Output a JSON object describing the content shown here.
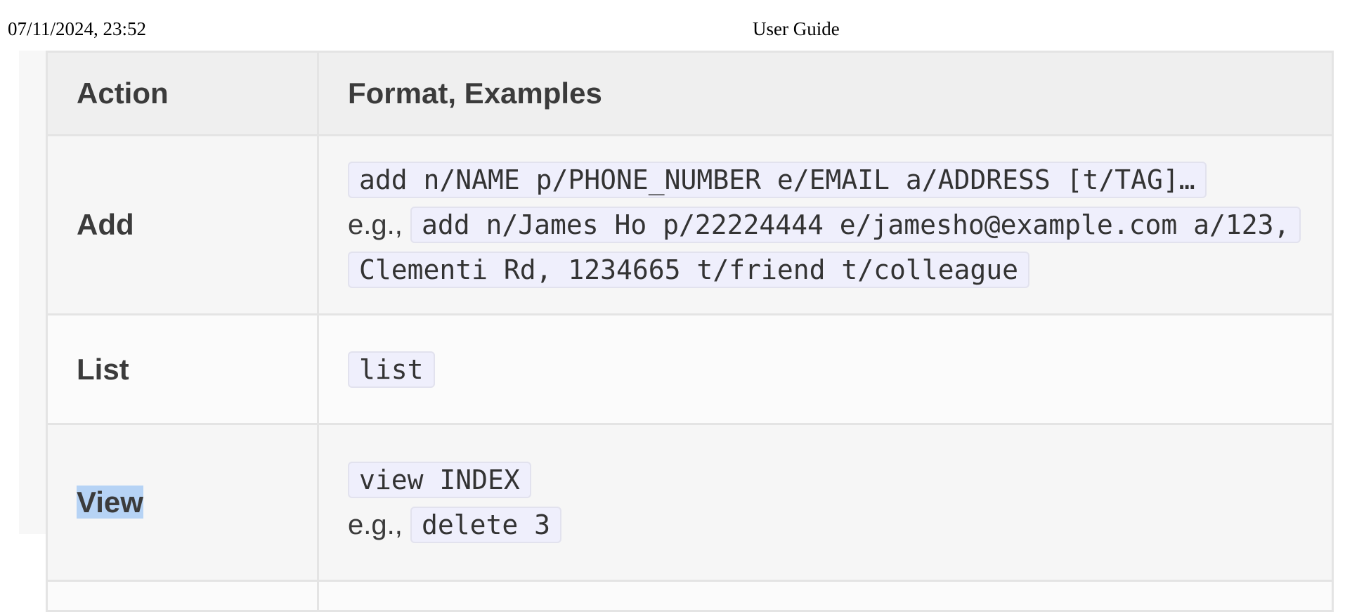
{
  "print_header": {
    "datetime": "07/11/2024, 23:52",
    "title": "User Guide"
  },
  "table": {
    "headers": [
      "Action",
      "Format, Examples"
    ],
    "rows": [
      {
        "action": "Add",
        "format": "add n/NAME p/PHONE_NUMBER e/EMAIL a/ADDRESS [t/TAG]…",
        "example_prefix": "e.g.,",
        "example": "add n/James Ho p/22224444 e/jamesho@example.com a/123, Clementi Rd, 1234665 t/friend t/colleague"
      },
      {
        "action": "List",
        "format": "list"
      },
      {
        "action": "View",
        "format": "view INDEX",
        "example_prefix": "e.g.,",
        "example": "delete 3",
        "action_selected": true
      }
    ]
  },
  "colors": {
    "code_background": "#efeffc",
    "selection_highlight": "#b6d3f5",
    "header_background": "#efefef"
  }
}
